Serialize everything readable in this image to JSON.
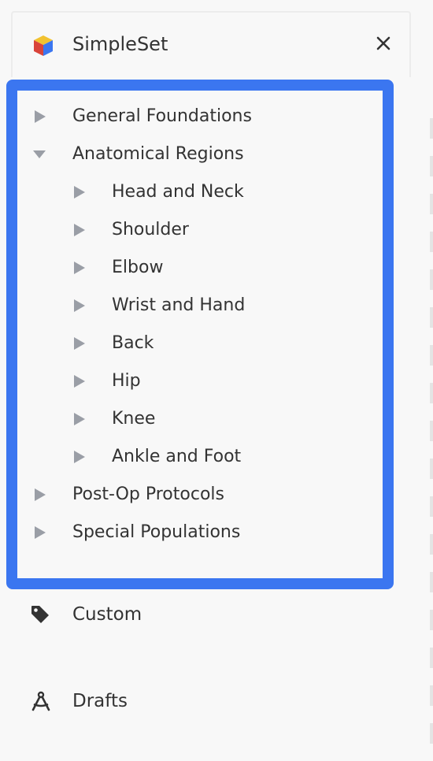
{
  "app": {
    "title": "SimpleSet"
  },
  "header": {
    "close_glyph": "✕"
  },
  "tree": [
    {
      "label": "General Foundations",
      "level": 0,
      "expanded": false
    },
    {
      "label": "Anatomical Regions",
      "level": 0,
      "expanded": true
    },
    {
      "label": "Head and Neck",
      "level": 1,
      "expanded": false
    },
    {
      "label": "Shoulder",
      "level": 1,
      "expanded": false
    },
    {
      "label": "Elbow",
      "level": 1,
      "expanded": false
    },
    {
      "label": "Wrist and Hand",
      "level": 1,
      "expanded": false
    },
    {
      "label": "Back",
      "level": 1,
      "expanded": false
    },
    {
      "label": "Hip",
      "level": 1,
      "expanded": false
    },
    {
      "label": "Knee",
      "level": 1,
      "expanded": false
    },
    {
      "label": "Ankle and Foot",
      "level": 1,
      "expanded": false
    },
    {
      "label": "Post-Op Protocols",
      "level": 0,
      "expanded": false
    },
    {
      "label": "Special Populations",
      "level": 0,
      "expanded": false
    }
  ],
  "nav": {
    "custom": {
      "label": "Custom",
      "icon": "tag-icon"
    },
    "drafts": {
      "label": "Drafts",
      "icon": "compass-icon"
    }
  },
  "colors": {
    "highlight": "#3b76f0",
    "caret": "#9a9ea6",
    "text": "#333333",
    "background": "#f8f8f8"
  }
}
